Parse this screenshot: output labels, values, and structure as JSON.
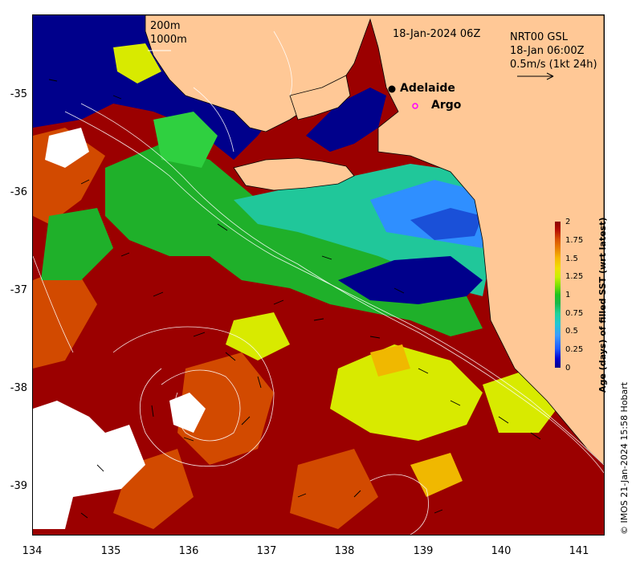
{
  "map": {
    "date_title": "18-Jan-2024 06Z",
    "product_line1": "NRT00 GSL",
    "product_line2": "18-Jan 06:00Z",
    "product_line3": "0.5m/s (1kt 24h)",
    "isobath_label_1": "200m",
    "isobath_label_2": "1000m",
    "places": [
      {
        "name": "Adelaide",
        "marker": "filled-circle",
        "lon": 138.6,
        "lat": -34.93
      },
      {
        "name": "Argo",
        "marker": "open-circle-magenta",
        "lon": 138.9,
        "lat": -35.1
      }
    ],
    "extent": {
      "lon_min": 134.0,
      "lon_max": 141.3,
      "lat_min": -39.45,
      "lat_max": -34.2
    },
    "y_ticks": [
      "-35",
      "-36",
      "-37",
      "-38",
      "-39"
    ],
    "x_ticks": [
      "134",
      "135",
      "136",
      "137",
      "138",
      "139",
      "140",
      "141"
    ]
  },
  "colorbar": {
    "title": "Age (days) of filled SST (wrt latest)",
    "ticks": [
      "2",
      "1.75",
      "1.5",
      "1.25",
      "1",
      "0.75",
      "0.5",
      "0.25",
      "0"
    ],
    "range": [
      0,
      2
    ]
  },
  "credit": "© IMOS 21-Jan-2024 15:58 Hobart",
  "colors": {
    "land": "#ffc896",
    "deep_blue": "#00008b",
    "dark_red": "#9b0000",
    "argo_marker": "#ff00ff"
  }
}
